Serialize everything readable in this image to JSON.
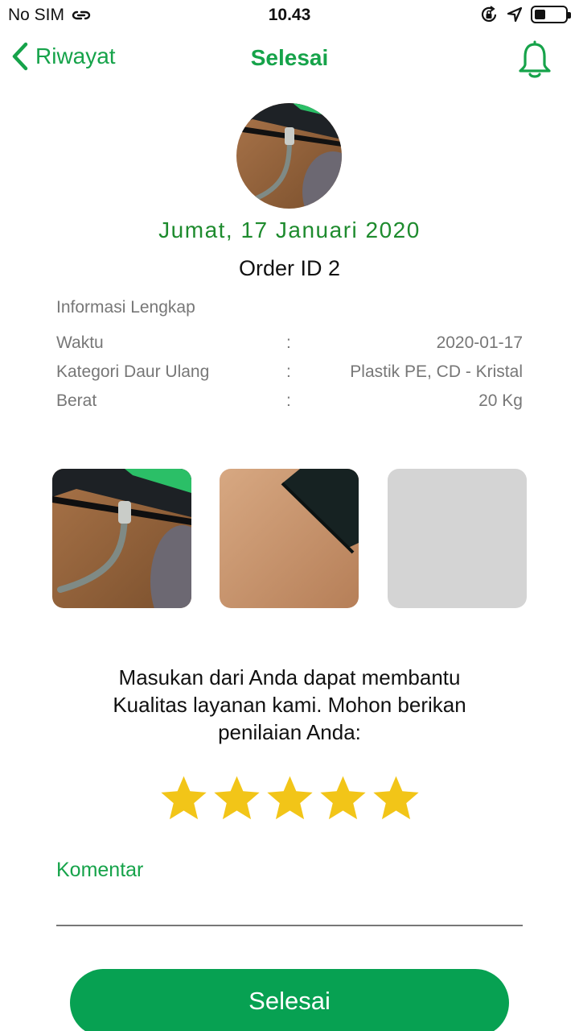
{
  "status_bar": {
    "carrier": "No SIM",
    "time": "10.43",
    "battery_level": 0.35
  },
  "nav": {
    "back_label": "Riwayat",
    "title": "Selesai"
  },
  "order": {
    "date": "Jumat, 17 Januari 2020",
    "order_id": "Order ID 2"
  },
  "info": {
    "title": "Informasi Lengkap",
    "rows": [
      {
        "key": "Waktu",
        "sep": ":",
        "value": "2020-01-17"
      },
      {
        "key": "Kategori Daur Ulang",
        "sep": ":",
        "value": "Plastik PE, CD - Kristal"
      },
      {
        "key": "Berat",
        "sep": ":",
        "value": "20 Kg"
      }
    ]
  },
  "feedback": {
    "line1": "Masukan dari Anda dapat membantu",
    "line2": "Kualitas layanan kami. Mohon berikan",
    "line3": "penilaian Anda:",
    "rating": 5,
    "rating_max": 5,
    "star_color": "#f2c518"
  },
  "comment": {
    "label": "Komentar",
    "value": ""
  },
  "submit": {
    "label": "Selesai"
  },
  "colors": {
    "accent": "#16a34a",
    "date": "#1e8b2e",
    "button": "#07a152",
    "placeholder_tile": "#d4d4d4"
  },
  "icons": {
    "wifi": "link-icon",
    "orientation_lock": "orientation-lock-icon",
    "location": "location-arrow-icon",
    "back": "chevron-left-icon",
    "bell": "bell-icon"
  }
}
